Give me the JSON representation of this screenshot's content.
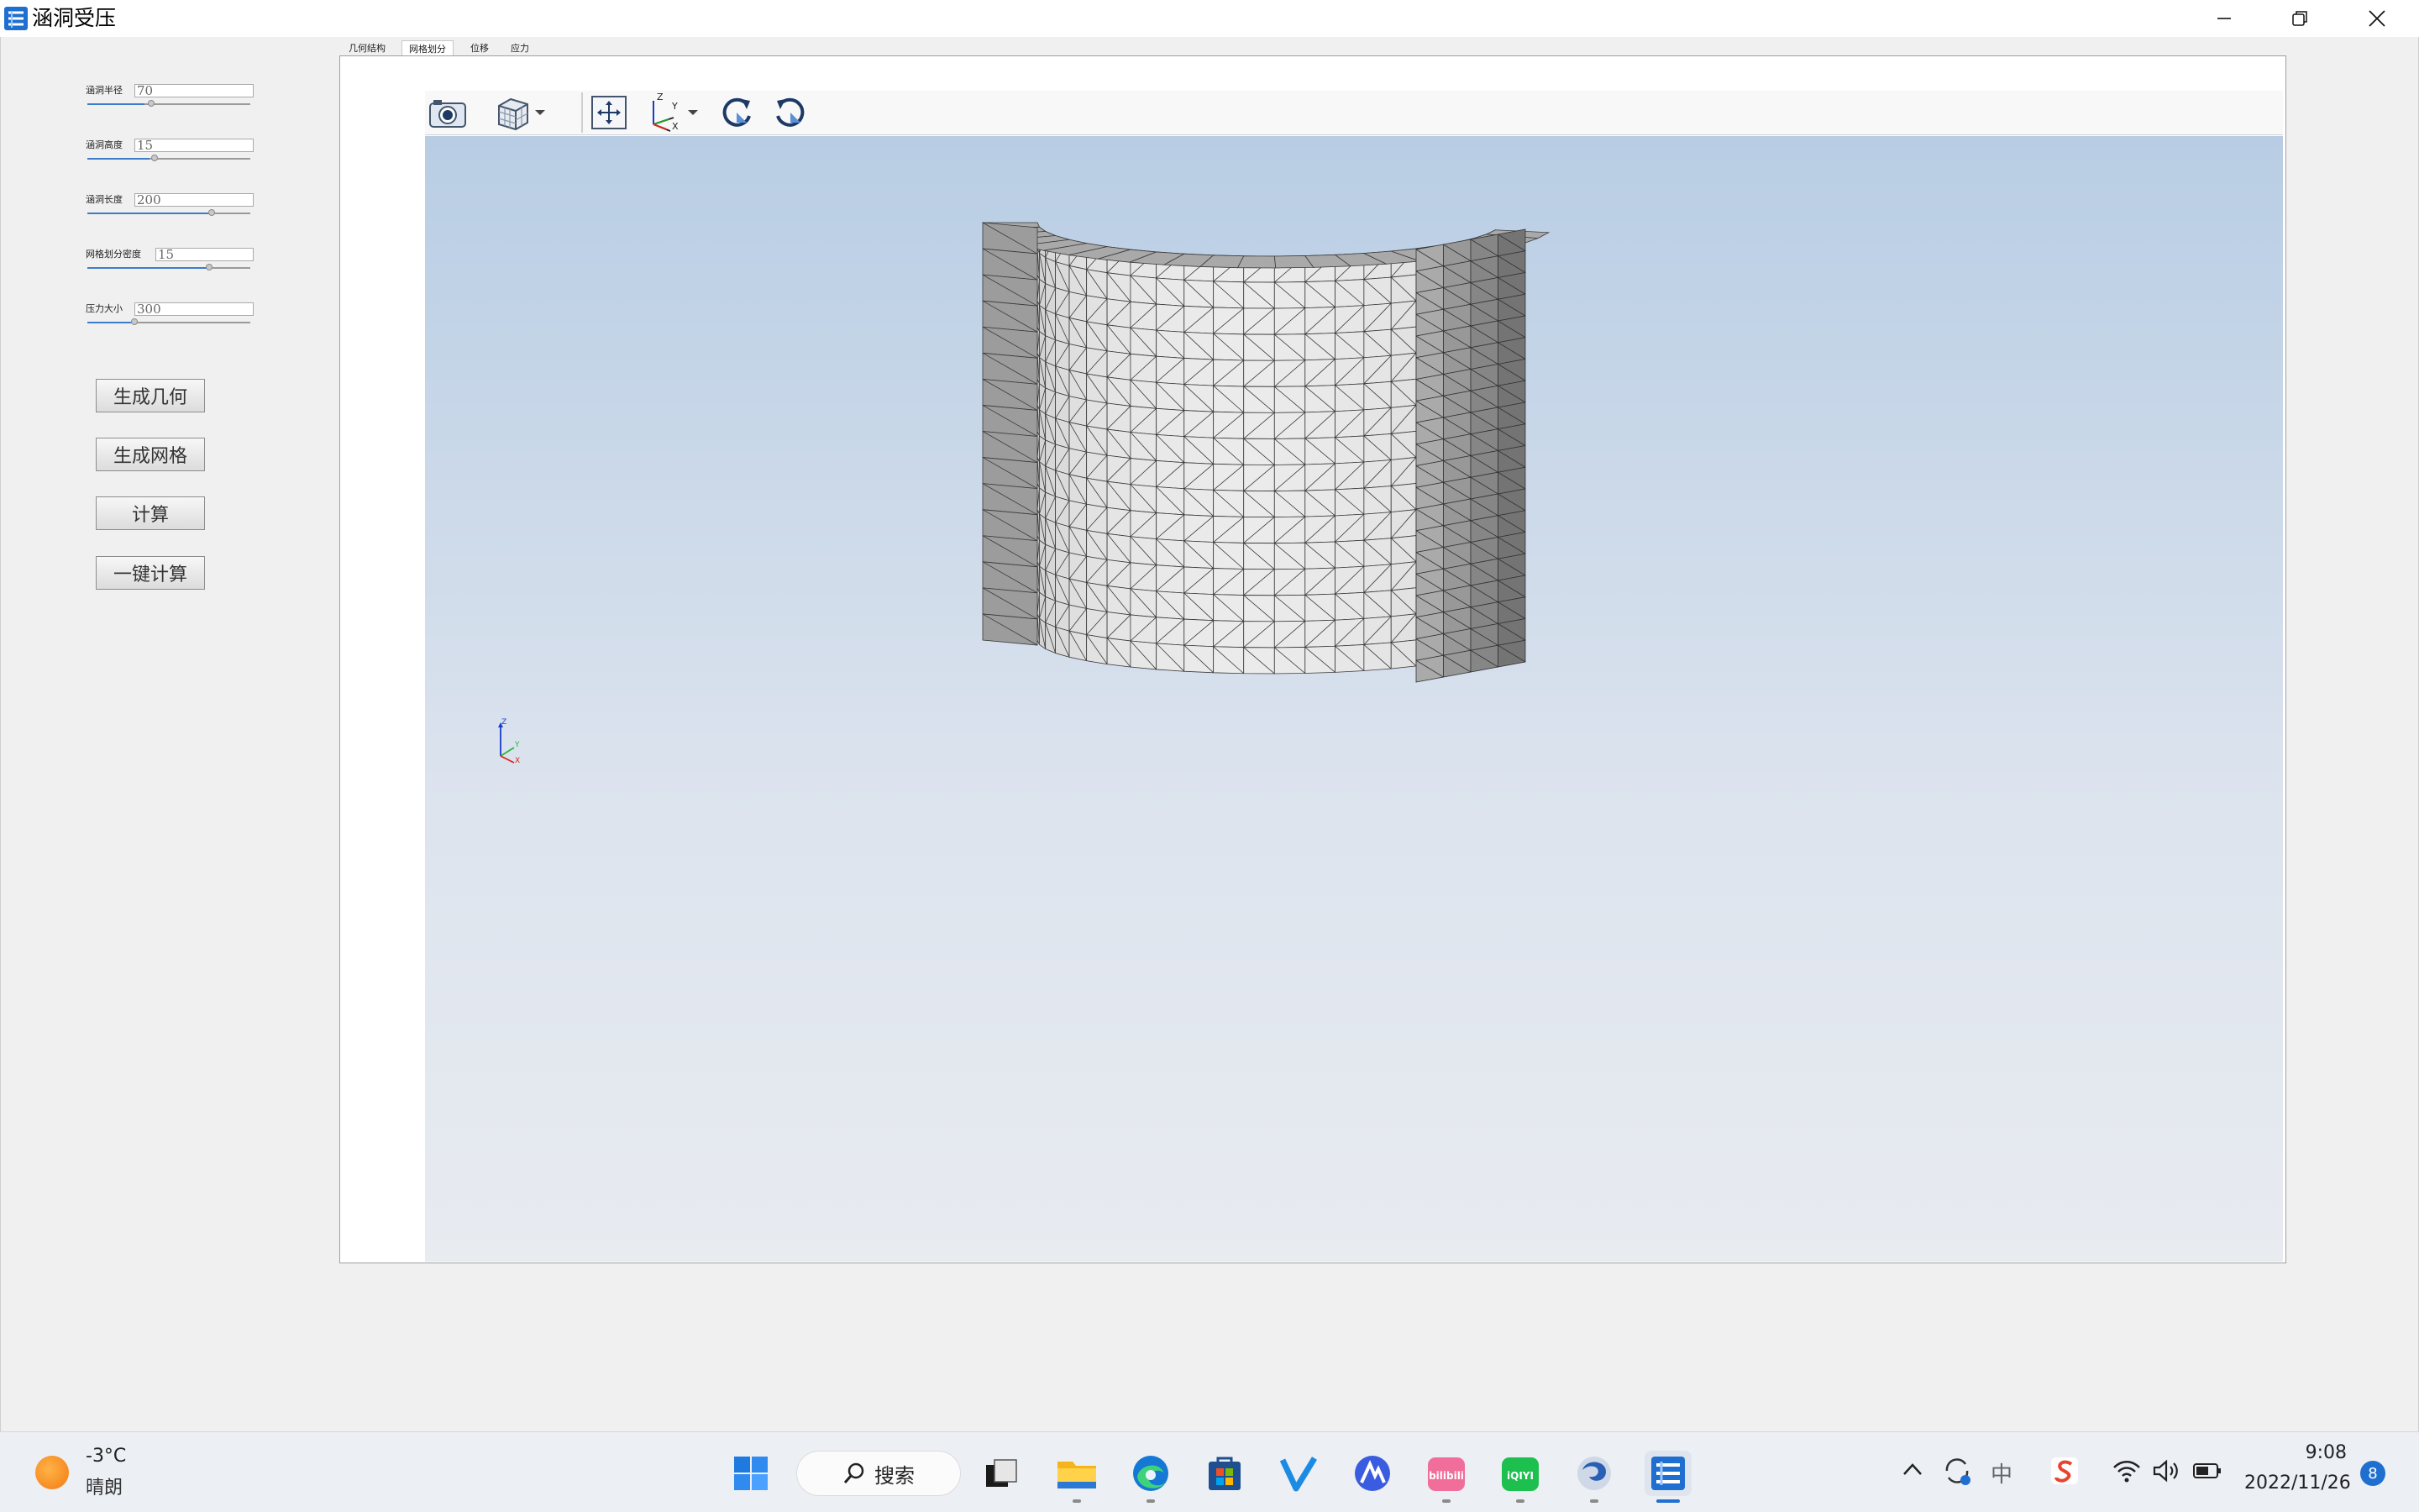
{
  "window": {
    "title": "涵洞受压"
  },
  "params": [
    {
      "label": "涵洞半径",
      "value": "70",
      "level": 0.35
    },
    {
      "label": "涵洞高度",
      "value": "15",
      "level": 0.38
    },
    {
      "label": "涵洞长度",
      "value": "200",
      "level": 0.74
    },
    {
      "label": "网格划分密度",
      "value": "15",
      "level": 0.73
    },
    {
      "label": "压力大小",
      "value": "300",
      "level": 0.27
    }
  ],
  "buttons": {
    "gen_geometry": "生成几何",
    "gen_mesh": "生成网格",
    "compute": "计算",
    "one_click": "一键计算"
  },
  "tabs": [
    "几何结构",
    "网格划分",
    "位移",
    "应力"
  ],
  "active_tab": "网格划分",
  "toolbar_icons": [
    "camera-icon",
    "cube-view-icon",
    "fit-view-icon",
    "axes-icon",
    "rotate-cw-icon",
    "rotate-ccw-icon"
  ],
  "axes_triad": {
    "z": "Z",
    "y": "Y",
    "x": "X"
  },
  "taskbar": {
    "weather_temp": "-3°C",
    "weather_desc": "晴朗",
    "search_label": "搜索",
    "ime": "中",
    "time": "9:08",
    "date": "2022/11/26",
    "notification_count": "8",
    "apps": [
      "windows-start",
      "file-explorer",
      "edge",
      "store",
      "app-v",
      "app-a",
      "bilibili",
      "iqiyi",
      "app-swirl",
      "culvert-app"
    ]
  },
  "colors": {
    "accent": "#3d7cc9",
    "viewport_top": "#b8cde4",
    "viewport_bottom": "#e8ebf0"
  }
}
